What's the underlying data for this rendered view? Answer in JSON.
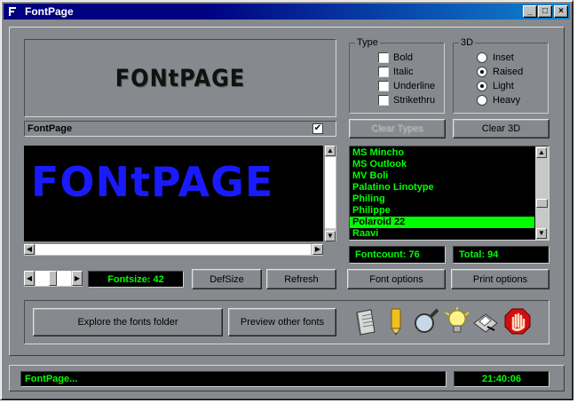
{
  "window": {
    "title": "FontPage",
    "controls": [
      "_",
      "□",
      "×"
    ]
  },
  "preview": {
    "logo_text": "FONtPAGE",
    "large_text": "FONtPAGE"
  },
  "sample_field": {
    "value": "FontPage",
    "checked": true
  },
  "type_group": {
    "legend": "Type",
    "options": [
      {
        "label": "Bold",
        "checked": false
      },
      {
        "label": "Italic",
        "checked": false
      },
      {
        "label": "Underline",
        "checked": false
      },
      {
        "label": "Strikethru",
        "checked": false
      }
    ]
  },
  "d3_group": {
    "legend": "3D",
    "options": [
      {
        "label": "Inset",
        "selected": false
      },
      {
        "label": "Raised",
        "selected": true
      },
      {
        "label": "Light",
        "selected": true
      },
      {
        "label": "Heavy",
        "selected": false
      }
    ]
  },
  "buttons": {
    "clear_types": "Clear Types",
    "clear_3d": "Clear 3D",
    "defsize": "DefSize",
    "refresh": "Refresh",
    "font_options": "Font options",
    "print_options": "Print options",
    "explore": "Explore the fonts folder",
    "preview_other": "Preview other fonts"
  },
  "font_list": {
    "items": [
      "MS Mincho",
      "MS Outlook",
      "MV Boli",
      "Palatino Linotype",
      "Philing",
      "Philippe",
      "Polaroid 22",
      "Raavi"
    ],
    "selected": "Polaroid 22"
  },
  "stats": {
    "fontcount": "Fontcount: 76",
    "total": "Total: 94",
    "fontsize": "Fontsize: 42"
  },
  "status": {
    "message": "FontPage...",
    "time": "21:40:06"
  },
  "toolbar_icons": [
    "notepad-icon",
    "pencil-icon",
    "magnifier-icon",
    "lightbulb-icon",
    "printer-icon",
    "stop-hand-icon"
  ],
  "colors": {
    "accent_green": "#00ff00",
    "preview_blue": "#1a1aff",
    "title_blue": "#000080"
  }
}
